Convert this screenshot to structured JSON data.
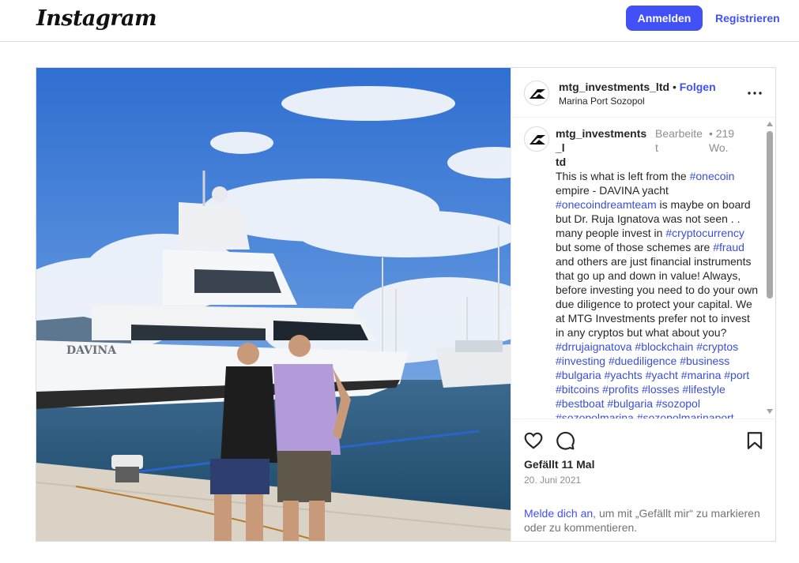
{
  "header": {
    "logo_text": "Instagram",
    "login_label": "Anmelden",
    "register_label": "Registrieren"
  },
  "post": {
    "username": "mtg_investments_ltd",
    "dot": "•",
    "follow_label": "Folgen",
    "location": "Marina Port Sozopol",
    "caption": {
      "username_line1": "mtg_investments_l",
      "username_line2": "td",
      "edited_line1": "Bearbeite",
      "edited_line2": "t",
      "age_line1": "219",
      "age_line2": "Wo.",
      "dot": "•",
      "segments": [
        {
          "t": "This is what is left from the "
        },
        {
          "t": "#onecoin",
          "tag": true
        },
        {
          "t": " empire - DAVINA yacht "
        },
        {
          "t": "#onecoindreamteam",
          "tag": true
        },
        {
          "t": " is maybe on board but Dr. Ruja Ignatova was not seen . . many people invest in "
        },
        {
          "t": "#cryptocurrency",
          "tag": true
        },
        {
          "t": " but some of those schemes are "
        },
        {
          "t": "#fraud",
          "tag": true
        },
        {
          "t": " and others are just financial instruments that go up and down in value! Always, before investing you need to do your own due diligence to protect your capital. We at MTG Investments prefer not to invest in any cryptos but what about you? "
        },
        {
          "t": "#drrujaignatova",
          "tag": true
        },
        {
          "t": " "
        },
        {
          "t": "#blockchain",
          "tag": true
        },
        {
          "t": " "
        },
        {
          "t": "#cryptos",
          "tag": true
        },
        {
          "t": " "
        },
        {
          "t": "#investing",
          "tag": true
        },
        {
          "t": " "
        },
        {
          "t": "#duediligence",
          "tag": true
        },
        {
          "t": " "
        },
        {
          "t": "#business",
          "tag": true
        },
        {
          "t": " "
        },
        {
          "t": "#bulgaria",
          "tag": true
        },
        {
          "t": " "
        },
        {
          "t": "#yachts",
          "tag": true
        },
        {
          "t": " "
        },
        {
          "t": "#yacht",
          "tag": true
        },
        {
          "t": " "
        },
        {
          "t": "#marina",
          "tag": true
        },
        {
          "t": " "
        },
        {
          "t": "#port",
          "tag": true
        },
        {
          "t": " "
        },
        {
          "t": "#bitcoins",
          "tag": true
        },
        {
          "t": " "
        },
        {
          "t": "#profits",
          "tag": true
        },
        {
          "t": " "
        },
        {
          "t": "#losses",
          "tag": true
        },
        {
          "t": " "
        },
        {
          "t": "#lifestyle",
          "tag": true
        },
        {
          "t": " "
        },
        {
          "t": "#bestboat",
          "tag": true
        },
        {
          "t": " "
        },
        {
          "t": "#bulgaria",
          "tag": true
        },
        {
          "t": " "
        },
        {
          "t": "#sozopol",
          "tag": true
        },
        {
          "t": " "
        },
        {
          "t": "#sozopolmarina",
          "tag": true
        },
        {
          "t": " "
        },
        {
          "t": "#sozopolmarinaport",
          "tag": true
        }
      ]
    },
    "likes": "Gefällt 11 Mal",
    "date": "20. Juni 2021",
    "login_prompt_link": "Melde dich an",
    "login_prompt_rest": ", um mit „Gefällt mir“ zu markieren oder zu kommentieren.",
    "boat_name": "DAVINA"
  },
  "icons": {
    "more": "more-horizontal-icon",
    "like": "heart-icon",
    "comment": "comment-icon",
    "save": "bookmark-icon"
  },
  "colors": {
    "accent": "#4150f7",
    "hashtag": "#3a4fd8",
    "border": "#dbdbdb",
    "muted": "#8e8e8e"
  }
}
